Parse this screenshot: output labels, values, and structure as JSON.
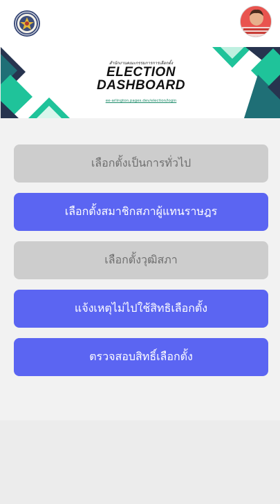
{
  "header": {
    "logo_icon": "agency-seal-icon",
    "avatar_icon": "user-avatar-photo"
  },
  "banner": {
    "subtitle": "สำนักงานคณะกรรมการการเลือกตั้ง",
    "title_line1": "ELECTION",
    "title_line2": "DASHBOARD",
    "url": "ee-arlington.pages.dev/election/login"
  },
  "menu": {
    "buttons": [
      {
        "label": "เลือกตั้งเป็นการทั่วไป",
        "state": "disabled"
      },
      {
        "label": "เลือกตั้งสมาชิกสภาผู้แทนราษฎร",
        "state": "active"
      },
      {
        "label": "เลือกตั้งวุฒิสภา",
        "state": "disabled"
      },
      {
        "label": "แจ้งเหตุไม่ไปใช้สิทธิเลือกตั้ง",
        "state": "active"
      },
      {
        "label": "ตรวจสอบสิทธิ์เลือกตั้ง",
        "state": "active"
      }
    ]
  },
  "colors": {
    "active_button": "#5b65f2",
    "disabled_button": "#cdcdcd",
    "teal": "#1fc39a",
    "navy": "#27344f"
  }
}
